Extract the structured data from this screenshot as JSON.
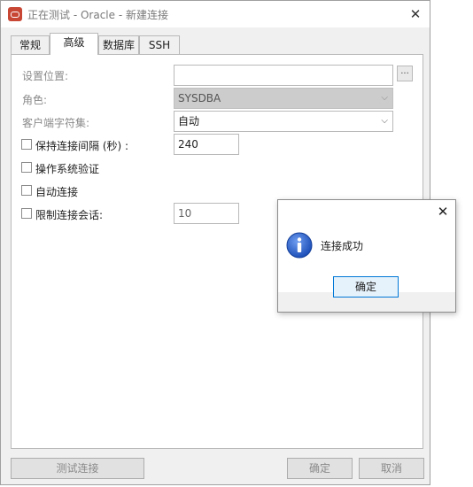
{
  "window": {
    "title": "正在测试 - Oracle - 新建连接",
    "tabs": [
      "常规",
      "高级",
      "数据库",
      "SSH"
    ],
    "active_tab": "高级"
  },
  "form": {
    "location_label": "设置位置:",
    "location_browse": "...",
    "role_label": "角色:",
    "role_value": "SYSDBA",
    "charset_label": "客户端字符集:",
    "charset_value": "自动",
    "keepalive_label": "保持连接间隔 (秒) :",
    "keepalive_value": "240",
    "os_auth_label": "操作系统验证",
    "auto_connect_label": "自动连接",
    "limit_sessions_label": "限制连接会话:",
    "limit_sessions_value": "10"
  },
  "buttons": {
    "test": "测试连接",
    "ok": "确定",
    "cancel": "取消"
  },
  "dialog": {
    "message": "连接成功",
    "ok": "确定"
  },
  "colors": {
    "accent": "#0078d7",
    "app_icon": "#c74634",
    "info_icon": "#1c4fb8"
  }
}
